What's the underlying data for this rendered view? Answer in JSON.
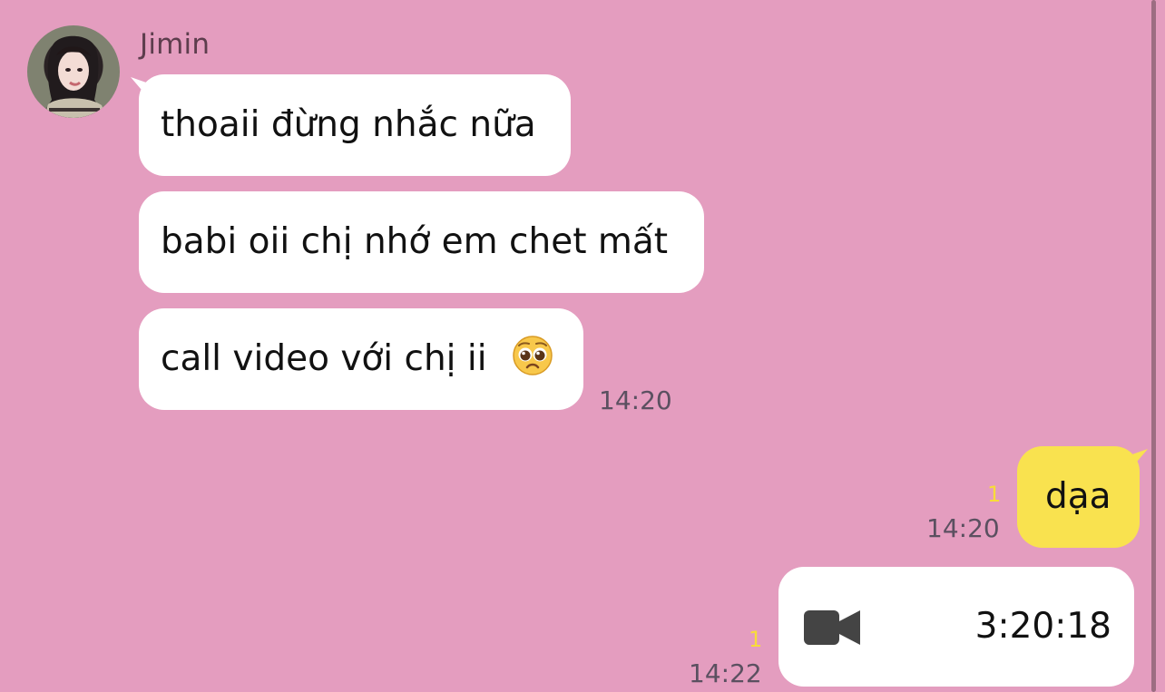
{
  "contact": {
    "name": "Jimin"
  },
  "messages": {
    "incoming": [
      {
        "text": "thoaii đừng nhắc nữa"
      },
      {
        "text": "babi oii chị nhớ em chet mất"
      },
      {
        "text": "call video với chị ii",
        "emoji": "pleading-face-icon"
      }
    ],
    "incoming_time": "14:20",
    "outgoing": [
      {
        "text": "dạa",
        "read_count": "1",
        "time": "14:20"
      },
      {
        "call_icon": "video-camera-icon",
        "duration": "3:20:18",
        "read_count": "1",
        "time": "14:22"
      }
    ]
  },
  "colors": {
    "background": "#e49dbf",
    "incoming_bubble": "#ffffff",
    "outgoing_bubble": "#f9e24f",
    "read_count": "#f8dc39",
    "time_text": "#5b5060"
  }
}
